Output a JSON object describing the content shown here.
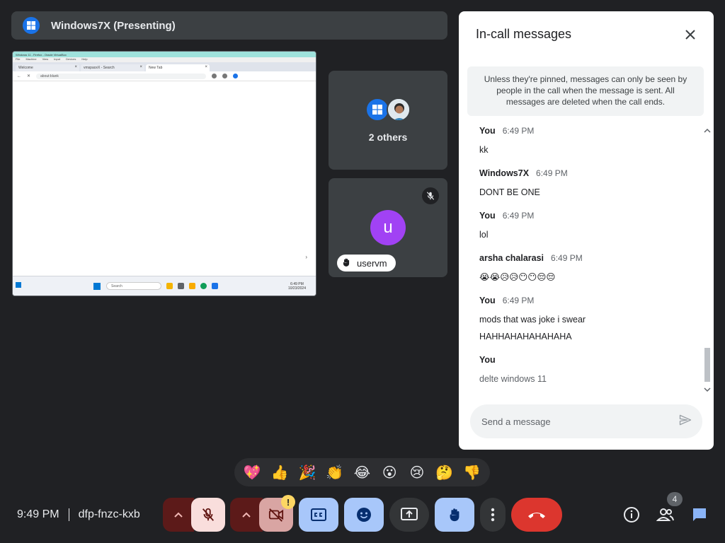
{
  "presenter": {
    "title": "Windows7X (Presenting)"
  },
  "shared_screen": {
    "window_title": "Windows 11 - Firefox - Oracle VirtualBox",
    "menu": [
      "File",
      "Machine",
      "View",
      "Input",
      "Devices",
      "Help"
    ],
    "tabs": [
      {
        "label": "Welcome"
      },
      {
        "label": "vmspaceX - Search"
      },
      {
        "label": "New Tab"
      }
    ],
    "url": "about:blank",
    "search_placeholder": "Search",
    "clock_time": "6:49 PM",
    "clock_date": "10/23/2024"
  },
  "tiles": {
    "others_label": "2 others",
    "user_initial": "u",
    "user_name": "uservm"
  },
  "chat": {
    "title": "In-call messages",
    "notice": "Unless they're pinned, messages can only be seen by people in the call when the message is sent. All messages are deleted when the call ends.",
    "messages": [
      {
        "sender": "You",
        "time": "6:49 PM",
        "lines": [
          "kk"
        ]
      },
      {
        "sender": "Windows7X",
        "time": "6:49 PM",
        "lines": [
          "DONT BE ONE"
        ]
      },
      {
        "sender": "You",
        "time": "6:49 PM",
        "lines": [
          "lol"
        ]
      },
      {
        "sender": "arsha chalarasi",
        "time": "6:49 PM",
        "lines": [
          "😭😭😥😥😶😶😔😔"
        ]
      },
      {
        "sender": "You",
        "time": "6:49 PM",
        "lines": [
          "mods that was joke i swear",
          "HAHHAHAHAHAHAHA"
        ]
      },
      {
        "sender": "You",
        "time": "",
        "lines": [
          "delte windows 11"
        ],
        "pending": true
      }
    ],
    "input_placeholder": "Send a message"
  },
  "reactions": [
    "💖",
    "👍",
    "🎉",
    "👏",
    "😂",
    "😮",
    "😢",
    "🤔",
    "👎"
  ],
  "bottom": {
    "time": "9:49 PM",
    "meeting_code": "dfp-fnzc-kxb",
    "warning_glyph": "!",
    "people_count": "4"
  },
  "colors": {
    "background": "#202124",
    "tile": "#3c4043",
    "accent_blue": "#a8c7fa",
    "end_call_red": "#dc362e",
    "avatar_purple": "#a142f4",
    "warning_yellow": "#fdd663"
  },
  "icons": {
    "presenter": "windows-logo-icon",
    "mic": "mic-off-icon",
    "camera": "camera-off-icon",
    "captions": "captions-icon",
    "emoji": "emoji-icon",
    "present": "present-screen-icon",
    "hand": "raise-hand-icon",
    "more": "more-vert-icon",
    "end": "end-call-icon",
    "info": "info-icon",
    "people": "people-icon",
    "chat": "chat-icon",
    "send": "send-icon",
    "close": "close-icon"
  }
}
